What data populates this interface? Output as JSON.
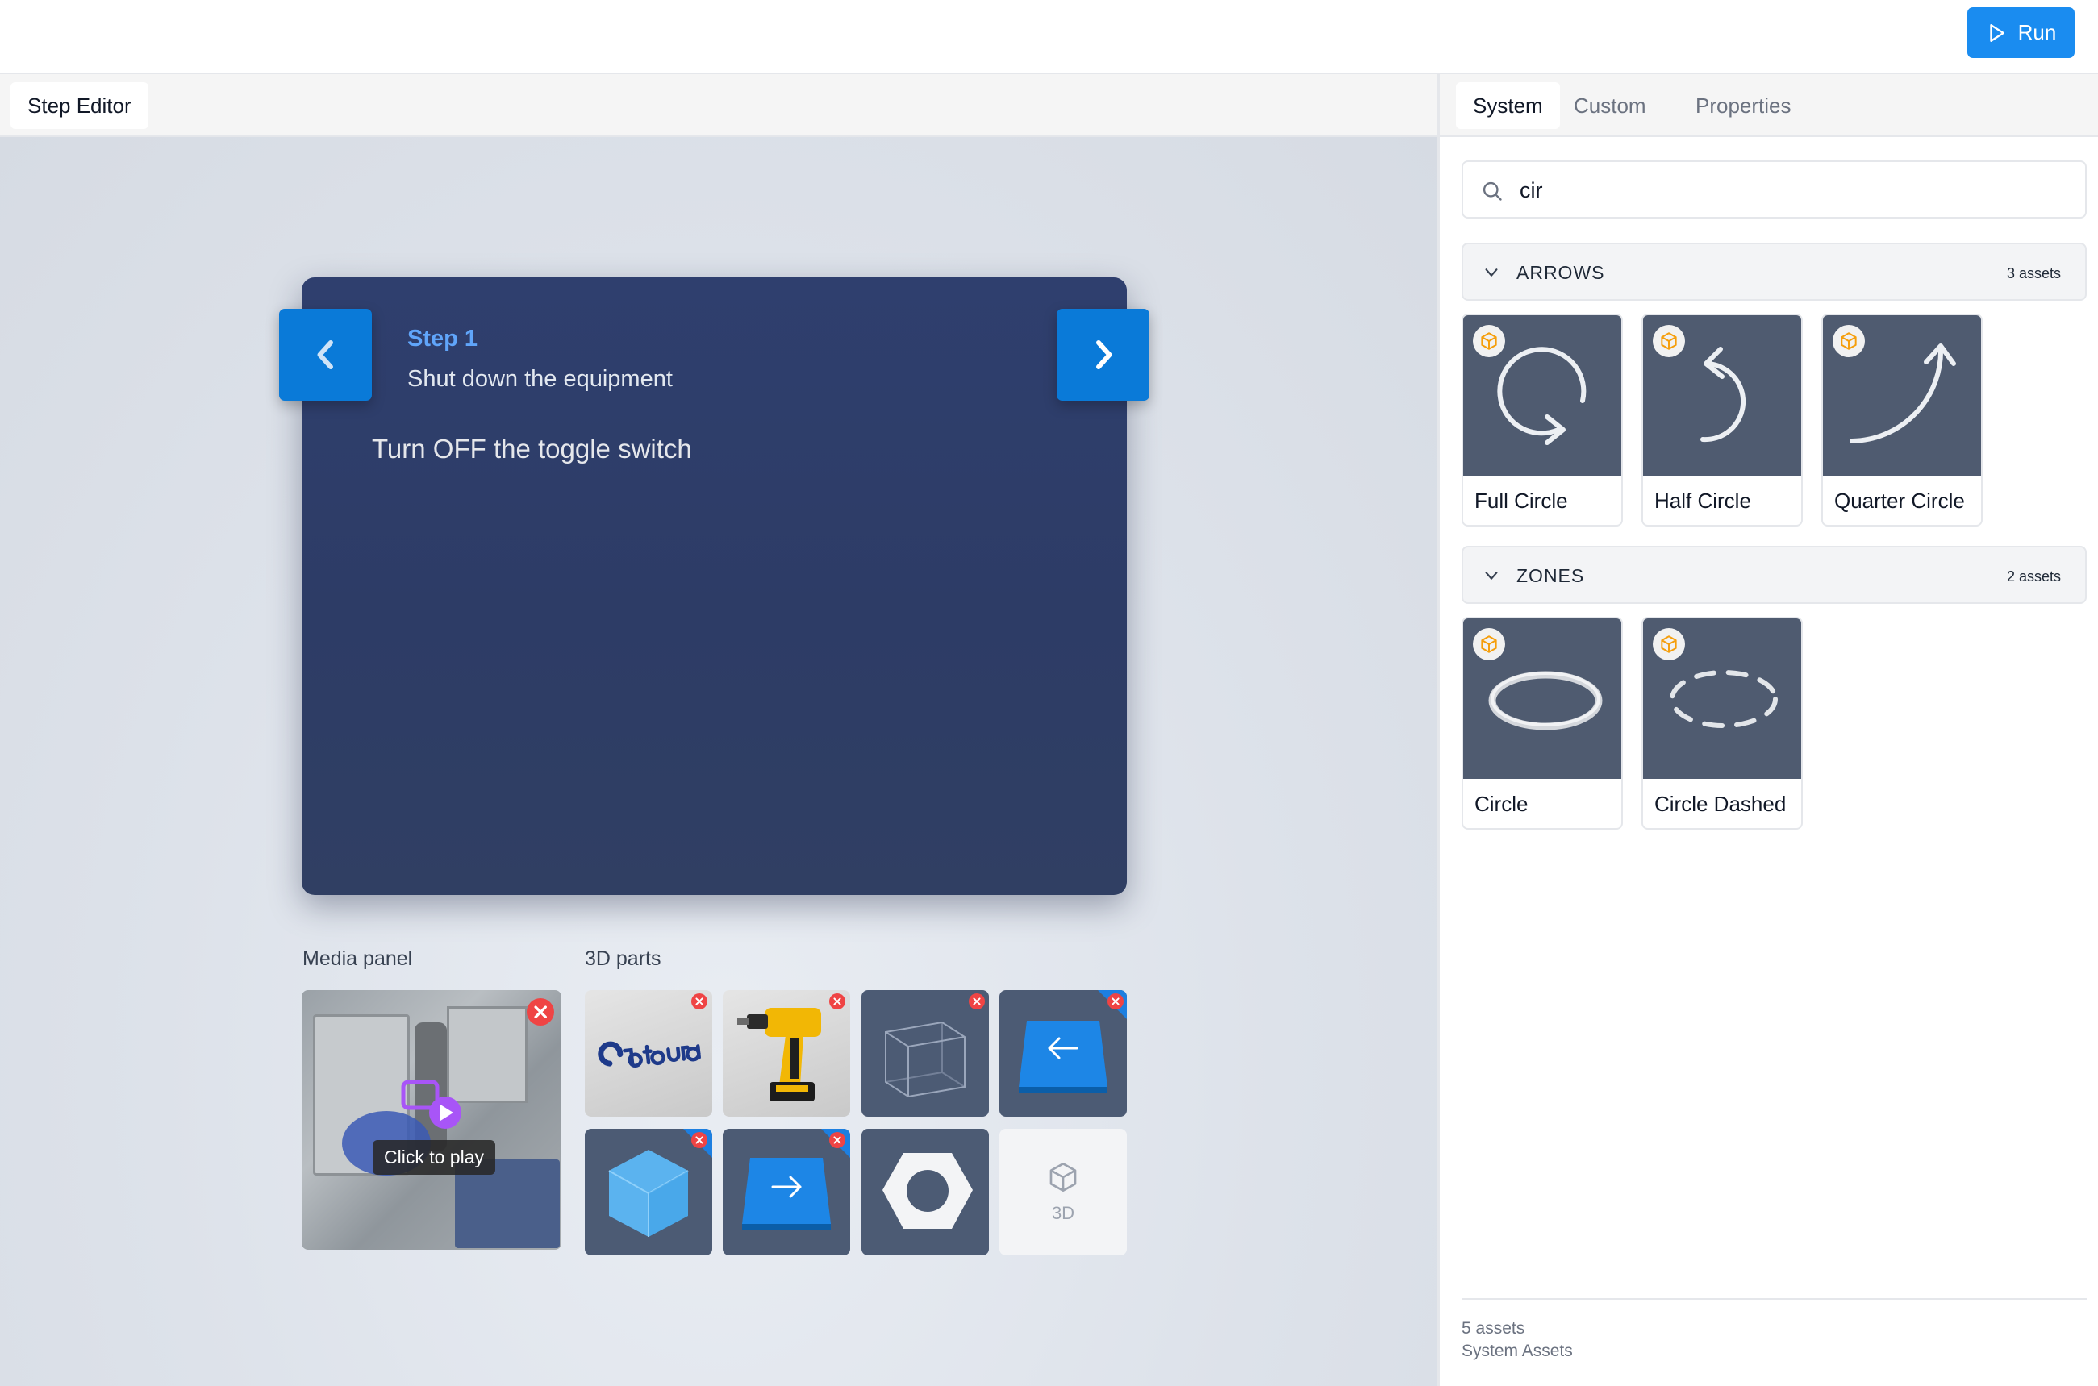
{
  "topbar": {
    "run_label": "Run"
  },
  "editor": {
    "tab_label": "Step Editor",
    "step": {
      "label": "Step 1",
      "subtitle": "Shut down the equipment",
      "instruction": "Turn OFF the toggle switch"
    },
    "media_panel": {
      "label": "Media panel",
      "tooltip": "Click to play"
    },
    "parts": {
      "label": "3D parts",
      "empty_slot_label": "3D"
    }
  },
  "right_panel": {
    "tabs": [
      {
        "label": "System",
        "active": true
      },
      {
        "label": "Custom",
        "active": false
      },
      {
        "label": "Properties",
        "active": false
      }
    ],
    "search": {
      "value": "cir"
    },
    "categories": [
      {
        "name": "ARROWS",
        "count": "3 assets",
        "assets": [
          {
            "name": "Full Circle",
            "icon": "full-circle-arrow"
          },
          {
            "name": "Half Circle",
            "icon": "half-circle-arrow"
          },
          {
            "name": "Quarter Circle",
            "icon": "quarter-circle-arrow"
          }
        ]
      },
      {
        "name": "ZONES",
        "count": "2 assets",
        "assets": [
          {
            "name": "Circle",
            "icon": "circle-zone"
          },
          {
            "name": "Circle Dashed",
            "icon": "circle-dashed-zone"
          }
        ]
      }
    ],
    "footer": {
      "count": "5 assets",
      "source": "System Assets"
    }
  },
  "colors": {
    "accent": "#1a8cf0",
    "nav_button": "#0a7ad8",
    "step_label": "#60a5fa",
    "card_bg": "#2f3f6e",
    "remove_badge": "#ef4444",
    "asset_thumb": "#4f5b70",
    "model_badge": "#f59e0b"
  }
}
